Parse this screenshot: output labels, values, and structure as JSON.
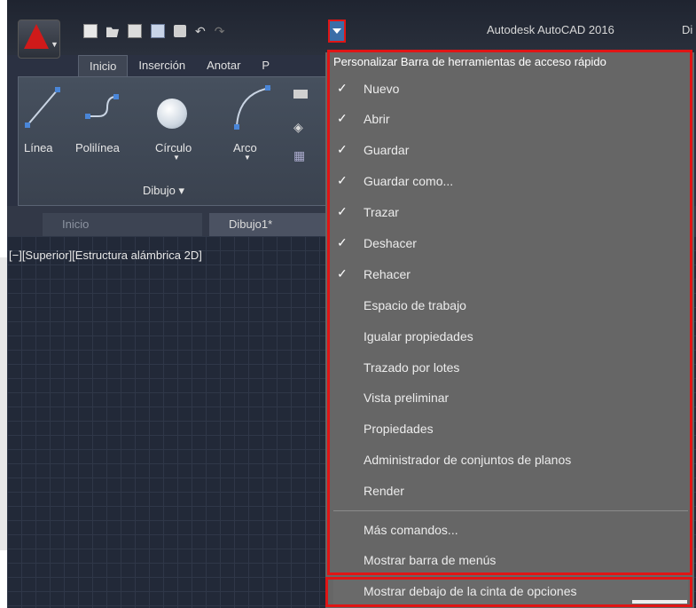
{
  "window": {
    "title": "Autodesk AutoCAD 2016",
    "title_suffix": "Di"
  },
  "ribbon": {
    "tabs": [
      "Inicio",
      "Inserción",
      "Anotar",
      "P"
    ],
    "tools": [
      "Línea",
      "Polilínea",
      "Círculo",
      "Arco"
    ],
    "panel_title": "Dibujo ▾"
  },
  "doc_tabs": [
    "Inicio",
    "Dibujo1*"
  ],
  "viewport": {
    "label": "[−][Superior][Estructura alámbrica 2D]"
  },
  "menu": {
    "header": "Personalizar Barra de herramientas de acceso rápido",
    "checked_items": [
      {
        "label": "Nuevo",
        "checked": true
      },
      {
        "label": "Abrir",
        "checked": true
      },
      {
        "label": "Guardar",
        "checked": true
      },
      {
        "label": "Guardar como...",
        "checked": true
      },
      {
        "label": "Trazar",
        "checked": true
      },
      {
        "label": "Deshacer",
        "checked": true
      },
      {
        "label": "Rehacer",
        "checked": true
      }
    ],
    "items": [
      "Espacio de trabajo",
      "Igualar propiedades",
      "Trazado por lotes",
      "Vista preliminar",
      "Propiedades",
      "Administrador de conjuntos de planos",
      "Render"
    ],
    "more": [
      "Más comandos...",
      "Mostrar barra de menús"
    ],
    "last": "Mostrar debajo de la cinta de opciones",
    "check_glyph": "✓"
  },
  "colors": {
    "highlight_border": "#e01515",
    "menu_bg": "#666666",
    "viewport_bg": "#222938"
  }
}
